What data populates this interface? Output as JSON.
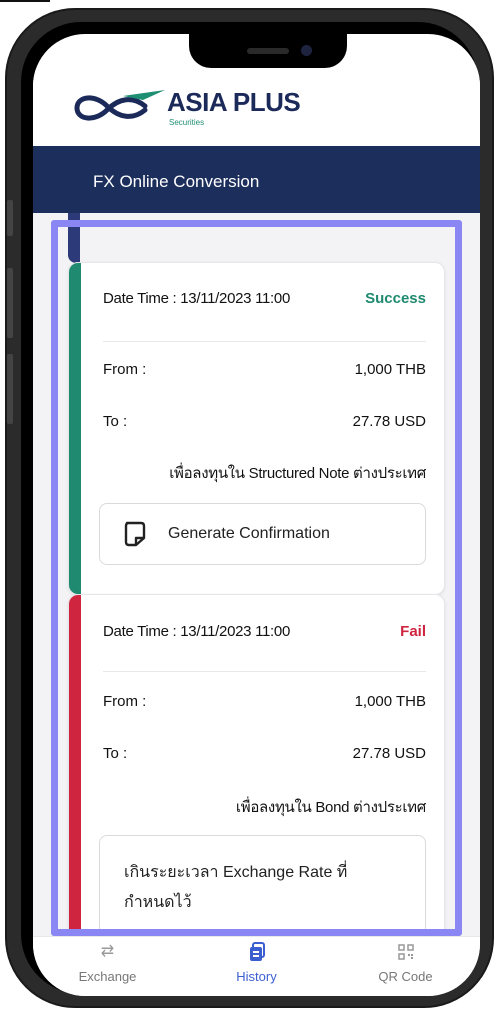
{
  "brand": {
    "name": "ASIA PLUS",
    "sub": "Securities",
    "colors": {
      "navy": "#1c2e5c",
      "green": "#1f8a70",
      "red": "#d0253f",
      "highlight": "#8a86f3",
      "active_nav": "#3b5fd1"
    }
  },
  "header": {
    "title": "FX Online Conversion"
  },
  "transactions": [
    {
      "datetime": "Date Time : 13/11/2023 11:00",
      "status": "Success",
      "from_label": "From :",
      "from_value": "1,000 THB",
      "to_label": "To :",
      "to_value": "27.78 USD",
      "purpose": "เพื่อลงทุนใน Structured Note ต่างประเทศ",
      "action_label": "Generate Confirmation",
      "action_icon": "document-icon"
    },
    {
      "datetime": "Date Time : 13/11/2023 11:00",
      "status": "Fail",
      "from_label": "From :",
      "from_value": "1,000 THB",
      "to_label": "To :",
      "to_value": "27.78 USD",
      "purpose": "เพื่อลงทุนใน Bond ต่างประเทศ",
      "fail_message_line1": "เกินระยะเวลา Exchange Rate ที่",
      "fail_message_line2": "กำหนดไว้"
    }
  ],
  "bottom_nav": [
    {
      "label": "Exchange",
      "icon": "exchange-icon",
      "active": false
    },
    {
      "label": "History",
      "icon": "history-icon",
      "active": true
    },
    {
      "label": "QR Code",
      "icon": "qr-code-icon",
      "active": false
    }
  ]
}
